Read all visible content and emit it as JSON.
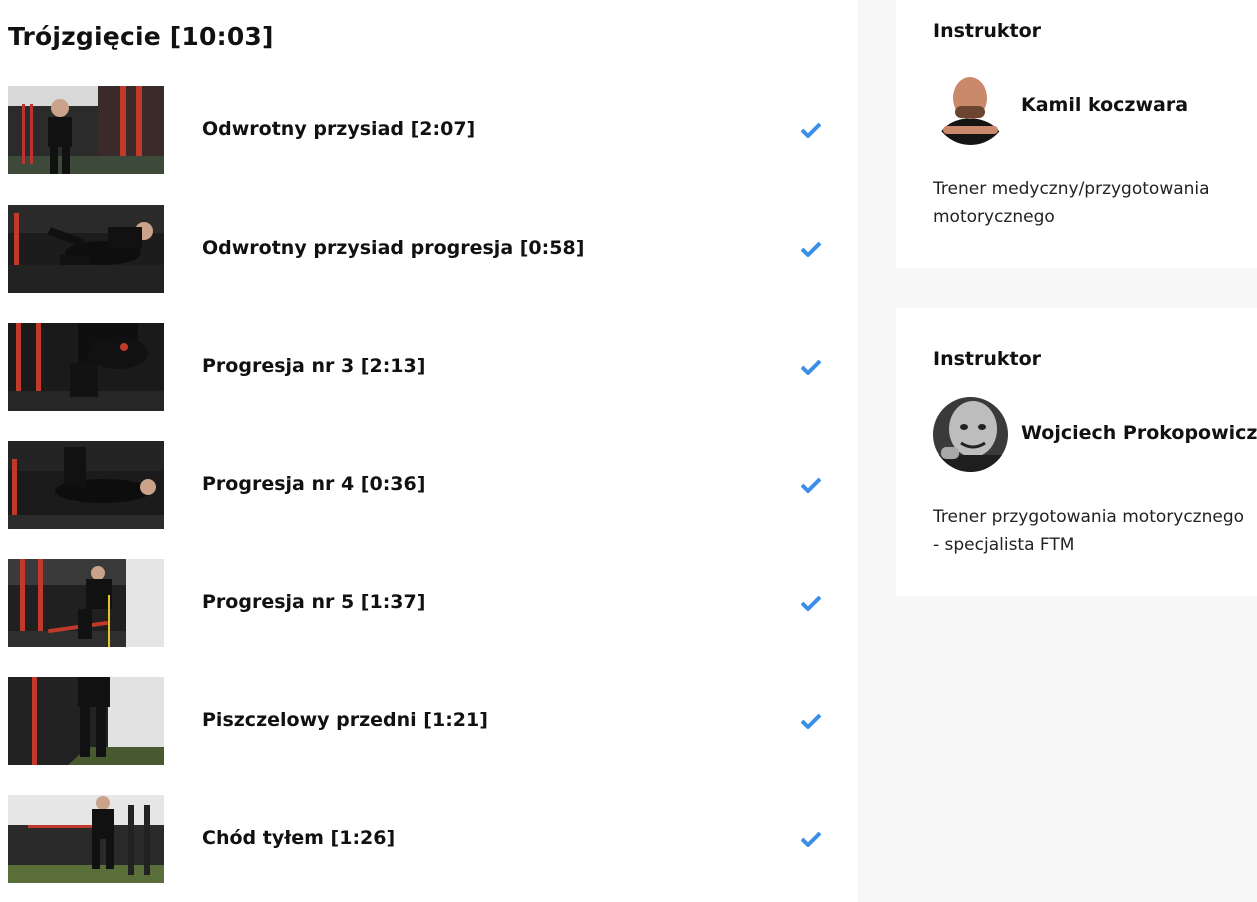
{
  "section": {
    "title": "Trójzgięcie [10:03]"
  },
  "lessons": [
    {
      "title": "Odwrotny przysiad [2:07]",
      "completed": true,
      "thumbnail": "gym-video-thumbnail"
    },
    {
      "title": "Odwrotny przysiad progresja [0:58]",
      "completed": true,
      "thumbnail": "gym-video-thumbnail"
    },
    {
      "title": "Progresja nr 3 [2:13]",
      "completed": true,
      "thumbnail": "gym-video-thumbnail"
    },
    {
      "title": "Progresja nr 4 [0:36]",
      "completed": true,
      "thumbnail": "gym-video-thumbnail"
    },
    {
      "title": "Progresja nr 5 [1:37]",
      "completed": true,
      "thumbnail": "gym-video-thumbnail"
    },
    {
      "title": "Piszczelowy przedni [1:21]",
      "completed": true,
      "thumbnail": "gym-video-thumbnail"
    },
    {
      "title": "Chód tyłem [1:26]",
      "completed": true,
      "thumbnail": "gym-video-thumbnail"
    }
  ],
  "instructors": [
    {
      "label": "Instruktor",
      "name": "Kamil koczwara",
      "description": "Trener medyczny/przygotowania motorycznego"
    },
    {
      "label": "Instruktor",
      "name": "Wojciech Prokopowicz",
      "description": "Trener przygotowania motorycznego - specjalista FTM"
    }
  ],
  "colors": {
    "check": "#3b8fe8",
    "sidebar_bg": "#f7f7f7",
    "text": "#111111"
  },
  "icons": {
    "check": "checkmark-icon"
  }
}
